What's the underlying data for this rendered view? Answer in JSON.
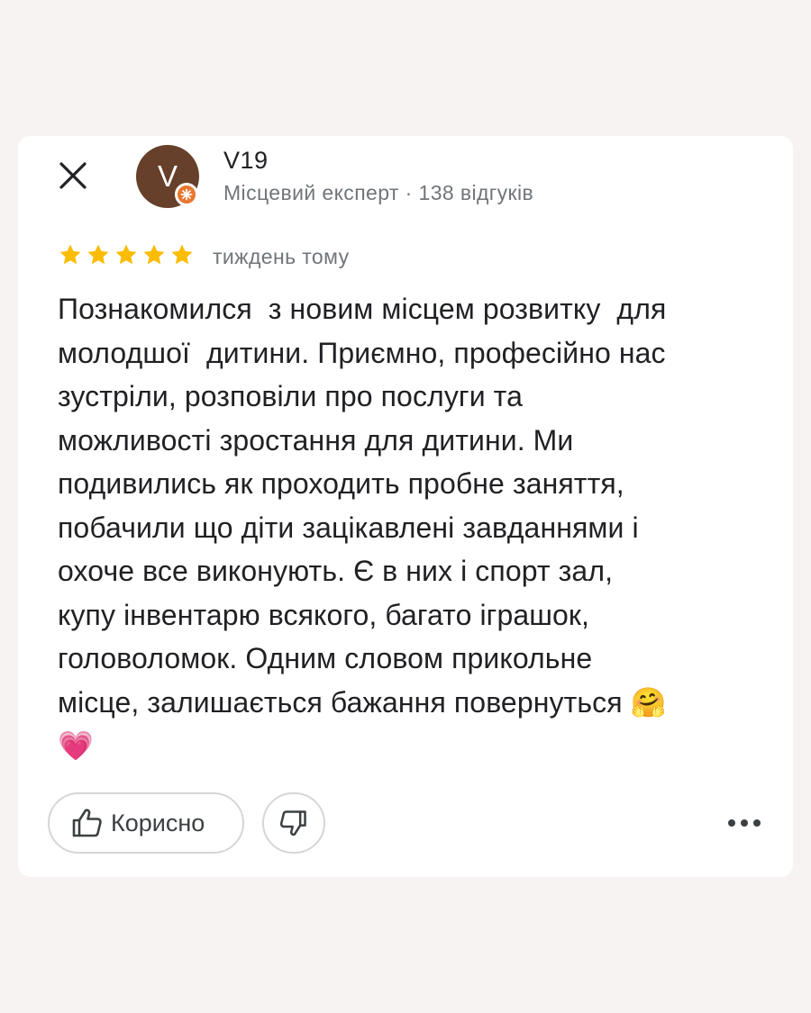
{
  "review": {
    "author": {
      "initial": "V",
      "name": "V19",
      "meta": "Місцевий експерт · 138 відгуків",
      "avatar_color": "#66402a",
      "badge_color": "#e8762e"
    },
    "rating": 5,
    "rating_max": 5,
    "star_color": "#fbbc04",
    "time_ago": "тиждень тому",
    "text": "Познакомился  з новим місцем розвитку  для\nмолодшої  дитини. Приємно, професійно нас\nзустріли, розповіли про послуги та\nможливості зростання для дитини. Ми\nподивились як проходить пробне заняття,\nпобачили що діти зацікавлені завданнями і\nохоче все виконують. Є в них і спорт зал,\nкупу інвентарю всякого, багато іграшок,\nголоволомок. Одним словом прикольне\nмісце, залишається бажання повернуться 🤗\n💗"
  },
  "actions": {
    "helpful_label": "Корисно",
    "helpful_icon": "thumbs-up-icon",
    "dislike_icon": "thumbs-down-icon",
    "more_icon": "more-dots-icon",
    "close_icon": "close-icon"
  }
}
